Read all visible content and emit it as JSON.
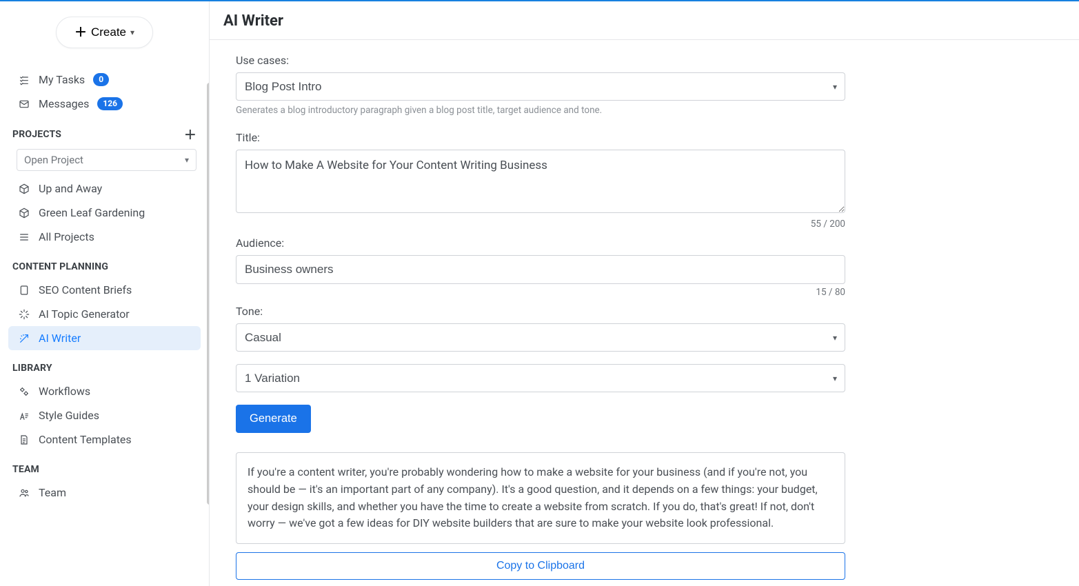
{
  "sidebar": {
    "create_label": "Create",
    "my_tasks": {
      "label": "My Tasks",
      "count": "0"
    },
    "messages": {
      "label": "Messages",
      "count": "126"
    },
    "sections": {
      "projects": {
        "title": "PROJECTS",
        "open_project": "Open Project",
        "items": [
          {
            "label": "Up and Away"
          },
          {
            "label": "Green Leaf Gardening"
          },
          {
            "label": "All Projects"
          }
        ]
      },
      "content_planning": {
        "title": "CONTENT PLANNING",
        "items": [
          {
            "label": "SEO Content Briefs"
          },
          {
            "label": "AI Topic Generator"
          },
          {
            "label": "AI Writer"
          }
        ]
      },
      "library": {
        "title": "LIBRARY",
        "items": [
          {
            "label": "Workflows"
          },
          {
            "label": "Style Guides"
          },
          {
            "label": "Content Templates"
          }
        ]
      },
      "team": {
        "title": "TEAM",
        "items": [
          {
            "label": "Team"
          }
        ]
      }
    }
  },
  "page": {
    "title": "AI Writer",
    "use_cases_label": "Use cases:",
    "use_cases": {
      "selected": "Blog Post Intro"
    },
    "use_cases_help": "Generates a blog introductory paragraph given a blog post title, target audience and tone.",
    "title_label": "Title:",
    "title_value": "How to Make A Website for Your Content Writing Business",
    "title_counter": "55 / 200",
    "audience_label": "Audience:",
    "audience_value": "Business owners",
    "audience_counter": "15 / 80",
    "tone_label": "Tone:",
    "tone_value": "Casual",
    "variation_value": "1 Variation",
    "generate_label": "Generate",
    "result_text": "If you're a content writer, you're probably wondering how to make a website for your business (and if you're not, you should be — it's an important part of any company). It's a good question, and it depends on a few things: your budget, your design skills, and whether you have the time to create a website from scratch. If you do, that's great! If not, don't worry — we've got a few ideas for DIY website builders that are sure to make your website look professional.",
    "copy_label": "Copy to Clipboard"
  }
}
